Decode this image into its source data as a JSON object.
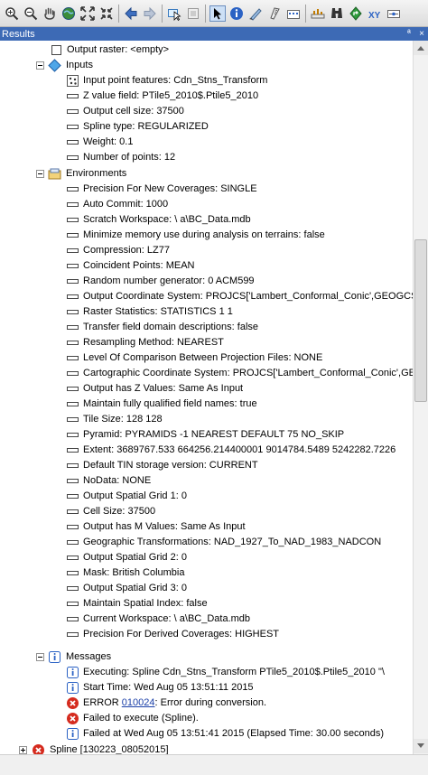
{
  "panel": {
    "title": "Results",
    "pin": "ª",
    "close": "×"
  },
  "colors": {
    "titlebar": "#3d6ab5",
    "error": "#d52b1e",
    "info": "#2b62c4"
  },
  "toolbar": {
    "buttons": [
      "zoom-in",
      "zoom-out",
      "pan",
      "full-extent",
      "fixed-zoom-in",
      "fixed-zoom-out",
      "back",
      "forward",
      "select-features",
      "clear-selection",
      "select-elements",
      "identify",
      "html-popup",
      "measure",
      "time-slider",
      "find",
      "go-to-xy"
    ]
  },
  "output_raster": "Output raster: <empty>",
  "inputs": {
    "header": "Inputs",
    "items": [
      "Input point features: Cdn_Stns_Transform",
      "Z value field: PTile5_2010$.Ptile5_2010",
      "Output cell size: 37500",
      "Spline type: REGULARIZED",
      "Weight: 0.1",
      "Number of points: 12"
    ]
  },
  "environments": {
    "header": "Environments",
    "items": [
      "Precision For New Coverages: SINGLE",
      "Auto Commit: 1000",
      "Scratch Workspace: \\                                        a\\BC_Data.mdb",
      "Minimize memory use during analysis on terrains: false",
      "Compression: LZ77",
      "Coincident Points: MEAN",
      "Random number generator: 0 ACM599",
      "Output Coordinate System: PROJCS['Lambert_Conformal_Conic',GEOGCS['GCS",
      "Raster Statistics: STATISTICS 1 1",
      "Transfer field domain descriptions: false",
      "Resampling Method: NEAREST",
      "Level Of Comparison Between Projection Files: NONE",
      "Cartographic Coordinate System: PROJCS['Lambert_Conformal_Conic',GEOGCS",
      "Output has Z Values: Same As Input",
      "Maintain fully qualified field names: true",
      "Tile Size: 128 128",
      "Pyramid: PYRAMIDS -1 NEAREST DEFAULT 75 NO_SKIP",
      "Extent: 3689767.533 664256.214400001 9014784.5489 5242282.7226",
      "Default TIN storage version: CURRENT",
      "NoData: NONE",
      "Output Spatial Grid 1: 0",
      "Cell Size: 37500",
      "Output has M Values: Same As Input",
      "Geographic Transformations: NAD_1927_To_NAD_1983_NADCON",
      "Output Spatial Grid 2: 0",
      "Mask: British Columbia",
      "Output Spatial Grid 3: 0",
      "Maintain Spatial Index: false",
      "Current Workspace: \\                                        a\\BC_Data.mdb",
      "Precision For Derived Coverages: HIGHEST"
    ]
  },
  "messages": {
    "header": "Messages",
    "executing": "Executing: Spline Cdn_Stns_Transform PTile5_2010$.Ptile5_2010 \"\\",
    "start_time": "Start Time: Wed Aug 05 13:51:11 2015",
    "error_prefix": "ERROR ",
    "error_code": "010024",
    "error_text": ": Error during conversion.",
    "failed_execute": "Failed to execute (Spline).",
    "failed_at": "Failed at Wed Aug 05 13:51:41 2015 (Elapsed Time: 30.00 seconds)"
  },
  "next_entry": "Spline [130223_08052015]"
}
